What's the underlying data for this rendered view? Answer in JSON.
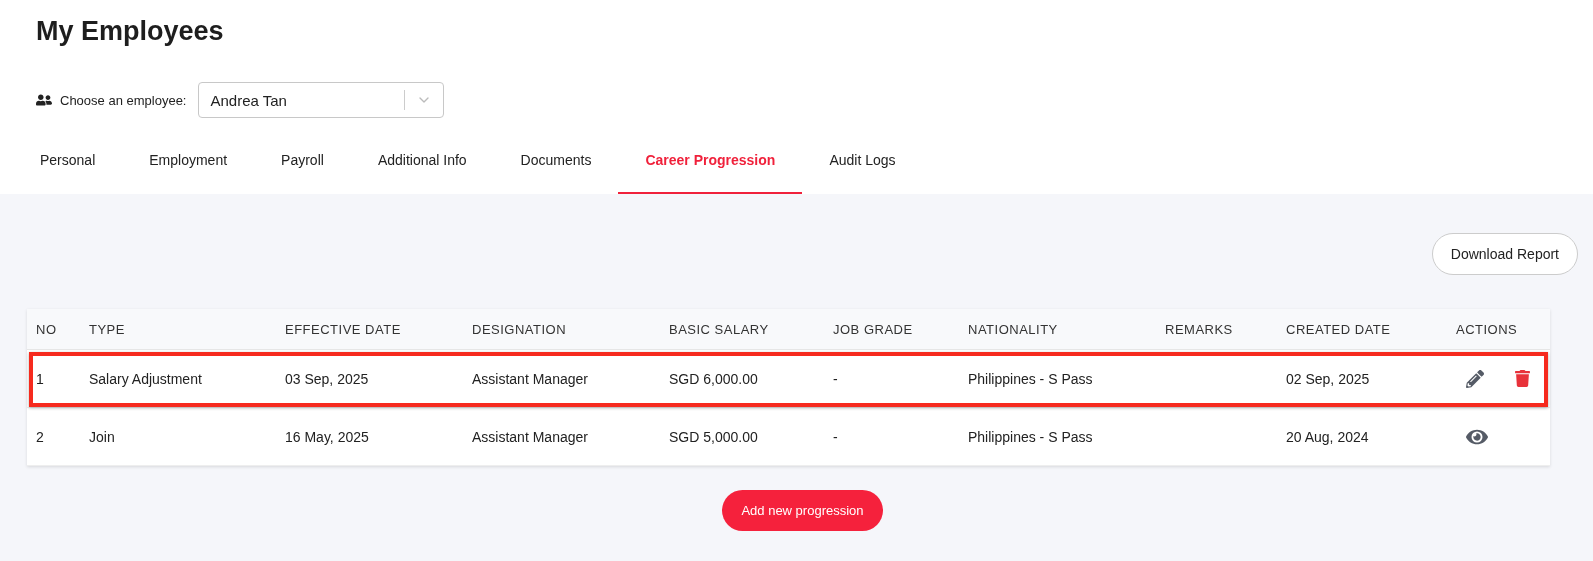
{
  "page_title": "My Employees",
  "employee_select": {
    "label": "Choose an employee:",
    "value": "Andrea Tan"
  },
  "tabs": [
    {
      "label": "Personal",
      "selected": false
    },
    {
      "label": "Employment",
      "selected": false
    },
    {
      "label": "Payroll",
      "selected": false
    },
    {
      "label": "Additional Info",
      "selected": false
    },
    {
      "label": "Documents",
      "selected": false
    },
    {
      "label": "Career Progression",
      "selected": true
    },
    {
      "label": "Audit Logs",
      "selected": false
    }
  ],
  "download_button": "Download Report",
  "table": {
    "columns": [
      "NO",
      "TYPE",
      "EFFECTIVE DATE",
      "DESIGNATION",
      "BASIC SALARY",
      "JOB GRADE",
      "NATIONALITY",
      "REMARKS",
      "CREATED DATE",
      "ACTIONS"
    ],
    "rows": [
      {
        "highlighted": true,
        "cells": [
          "1",
          "Salary Adjustment",
          "03 Sep, 2025",
          "Assistant Manager",
          "SGD 6,000.00",
          "-",
          "Philippines - S Pass",
          "",
          "02 Sep, 2025"
        ],
        "actions": [
          {
            "kind": "edit"
          },
          {
            "kind": "delete"
          }
        ]
      },
      {
        "highlighted": false,
        "cells": [
          "2",
          "Join",
          "16 May, 2025",
          "Assistant Manager",
          "SGD 5,000.00",
          "-",
          "Philippines - S Pass",
          "",
          "20 Aug, 2024"
        ],
        "actions": [
          {
            "kind": "view"
          }
        ]
      }
    ]
  },
  "add_button": "Add new progression"
}
